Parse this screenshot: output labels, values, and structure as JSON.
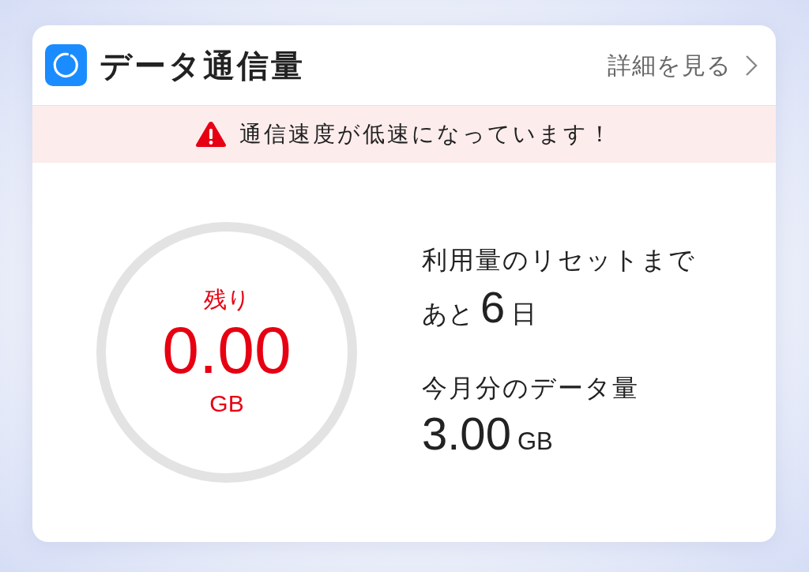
{
  "widget": {
    "title": "データ通信量",
    "details_link": "詳細を見る"
  },
  "alert": {
    "message": "通信速度が低速になっています！"
  },
  "remaining": {
    "label": "残り",
    "value": "0.00",
    "unit": "GB"
  },
  "reset": {
    "label": "利用量のリセットまで",
    "prefix": "あと",
    "days": "6",
    "suffix": "日"
  },
  "monthly": {
    "label": "今月分のデータ量",
    "value": "3.00",
    "unit": "GB"
  }
}
